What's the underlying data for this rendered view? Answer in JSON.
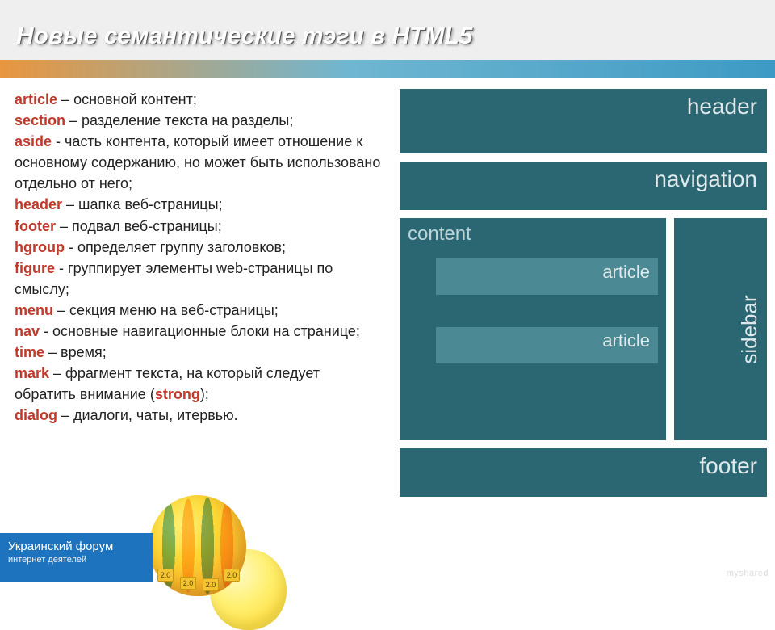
{
  "title": "Новые семантические тэги в HTML5",
  "definitions": [
    {
      "term": "article",
      "sep": " – ",
      "desc": "основной контент;"
    },
    {
      "term": "section",
      "sep": " – ",
      "desc": "разделение текста на разделы;"
    },
    {
      "term": "aside",
      "sep": " - ",
      "desc": "часть контента, который имеет отношение к основному содержанию, но может быть использовано отдельно от него;"
    },
    {
      "term": "header",
      "sep": " – ",
      "desc": "шапка веб-страницы;"
    },
    {
      "term": "footer",
      "sep": " – ",
      "desc": "подвал веб-страницы;"
    },
    {
      "term": "hgroup",
      "sep": " - ",
      "desc": "определяет группу заголовков;"
    },
    {
      "term": "figure",
      "sep": " - ",
      "desc": "группирует элементы web-страницы по смыслу;"
    },
    {
      "term": "menu",
      "sep": " – ",
      "desc": "секция меню на веб-страницы;"
    },
    {
      "term": "nav",
      "sep": " - ",
      "desc": "основные навигационные блоки на странице;"
    },
    {
      "term": "time",
      "sep": " – ",
      "desc": "время;"
    },
    {
      "term": "mark",
      "sep": " – ",
      "desc": "фрагмент текста, на который следует обратить внимание (",
      "strong": "strong",
      "desc2": ");"
    },
    {
      "term": "dialog",
      "sep": " – ",
      "desc": "диалоги, чаты, итервью."
    }
  ],
  "diagram": {
    "header": "header",
    "navigation": "navigation",
    "content": "content",
    "article1": "article",
    "article2": "article",
    "sidebar": "sidebar",
    "footer": "footer"
  },
  "badge": {
    "line1": "Украинский форум",
    "line2": "интернет деятелей"
  },
  "balloon_tag": "2.0",
  "watermark": "myshared"
}
